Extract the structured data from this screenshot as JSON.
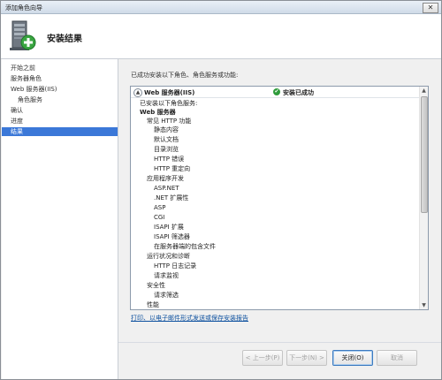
{
  "window": {
    "title": "添加角色向导",
    "close_symbol": "✕"
  },
  "header": {
    "title": "安装结果"
  },
  "nav": {
    "items": [
      {
        "label": "开始之前"
      },
      {
        "label": "服务器角色"
      },
      {
        "label": "Web 服务器(IIS)"
      },
      {
        "label": "角色服务"
      },
      {
        "label": "确认"
      },
      {
        "label": "进度"
      },
      {
        "label": "结果"
      }
    ],
    "selected": "结果"
  },
  "content": {
    "intro": "已成功安装以下角色、角色服务或功能:",
    "panel": {
      "collapse_symbol": "▲",
      "role": "Web 服务器(IIS)",
      "status": "安装已成功",
      "status_color": "#2e9b3a",
      "tree": [
        "已安装以下角色服务:",
        "Web 服务器",
        "常见 HTTP 功能",
        "静态内容",
        "默认文档",
        "目录浏览",
        "HTTP 错误",
        "HTTP 重定向",
        "应用程序开发",
        "ASP.NET",
        ".NET 扩展性",
        "ASP",
        "CGI",
        "ISAPI 扩展",
        "ISAPI 筛选器",
        "在服务器端的包含文件",
        "运行状况和诊断",
        "HTTP 日志记录",
        "请求监视",
        "安全性",
        "请求筛选",
        "性能"
      ]
    },
    "report_link": "打印、以电子邮件形式发送或保存安装报告"
  },
  "footer": {
    "prev": "< 上一步(P)",
    "next": "下一步(N) >",
    "close": "关闭(O)",
    "cancel": "取消"
  }
}
